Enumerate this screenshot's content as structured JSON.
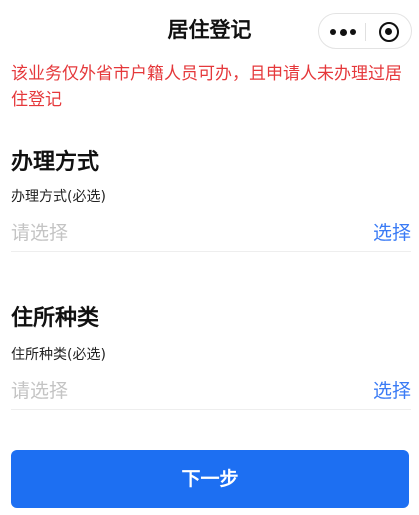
{
  "header": {
    "title": "居住登记"
  },
  "notice": "该业务仅外省市户籍人员可办，且申请人未办理过居住登记",
  "sections": [
    {
      "title": "办理方式",
      "label": "办理方式(必选)",
      "placeholder": "请选择",
      "action": "选择"
    },
    {
      "title": "住所种类",
      "label": "住所种类(必选)",
      "placeholder": "请选择",
      "action": "选择"
    }
  ],
  "next_button": "下一步",
  "colors": {
    "notice": "#e5383b",
    "link": "#3a7bf5",
    "primary_button": "#1d6ff2",
    "placeholder": "#c4c4c4"
  },
  "icons": {
    "menu": "more-dots-icon",
    "close": "target-circle-icon"
  }
}
